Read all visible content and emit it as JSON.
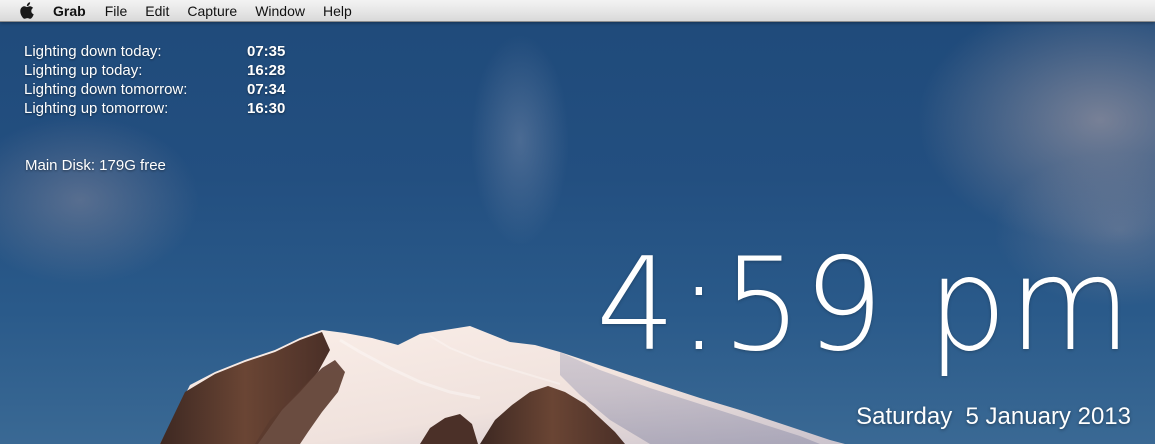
{
  "menubar": {
    "apple_icon": "apple-logo-icon",
    "app_name": "Grab",
    "items": [
      "File",
      "Edit",
      "Capture",
      "Window",
      "Help"
    ]
  },
  "info_panel": {
    "rows": [
      {
        "label": "Lighting down today:",
        "value": "07:35"
      },
      {
        "label": "Lighting up today:",
        "value": "16:28"
      },
      {
        "label": "Lighting down tomorrow:",
        "value": "07:34"
      },
      {
        "label": "Lighting up tomorrow:",
        "value": "16:30"
      }
    ],
    "disk": "Main Disk: 179G free"
  },
  "clock": {
    "time": "4:59 pm",
    "date": "Saturday  5 January 2013"
  },
  "colors": {
    "sky_top": "#1f4a7a",
    "sky_bottom": "#3a6994",
    "snow": "#f4e8e4",
    "rock": "#5a3a30"
  }
}
